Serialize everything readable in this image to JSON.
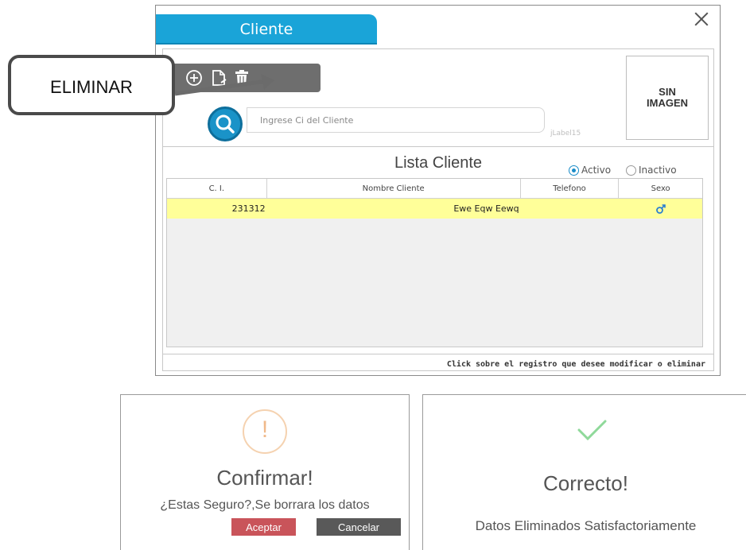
{
  "window": {
    "title": "Cliente",
    "close_glyph": "×",
    "toolbar": {
      "icons": [
        "add-icon",
        "edit-document-icon",
        "delete-trash-icon"
      ]
    },
    "search": {
      "placeholder": "Ingrese Ci del Cliente",
      "value": ""
    },
    "jlabel": "jLabel15",
    "image_placeholder": "SIN\nIMAGEN",
    "list_title": "Lista Cliente",
    "filter": {
      "options": [
        {
          "label": "Activo",
          "selected": true
        },
        {
          "label": "Inactivo",
          "selected": false
        }
      ]
    },
    "table": {
      "columns": [
        "C. I.",
        "Nombre Cliente",
        "Telefono",
        "Sexo"
      ],
      "rows": [
        {
          "ci": "231312",
          "nombre": "Ewe Eqw Eewq",
          "telefono": "",
          "sexo_icon": "male-icon"
        }
      ]
    },
    "footer_hint": "Click  sobre el registro que desee modificar o eliminar"
  },
  "callout": {
    "label": "ELIMINAR"
  },
  "confirm_dialog": {
    "icon_glyph": "!",
    "title": "Confirmar!",
    "message": "¿Estas Seguro?,Se borrara los datos",
    "accept_label": "Aceptar",
    "cancel_label": "Cancelar"
  },
  "success_dialog": {
    "title": "Correcto!",
    "message": "Datos Eliminados Satisfactoriamente"
  },
  "colors": {
    "accent": "#1aa4d8",
    "selected_row": "#ffff99",
    "accept": "#c9545a",
    "cancel": "#595959",
    "success_check": "#8fd99a",
    "warning": "#f0b98a"
  }
}
